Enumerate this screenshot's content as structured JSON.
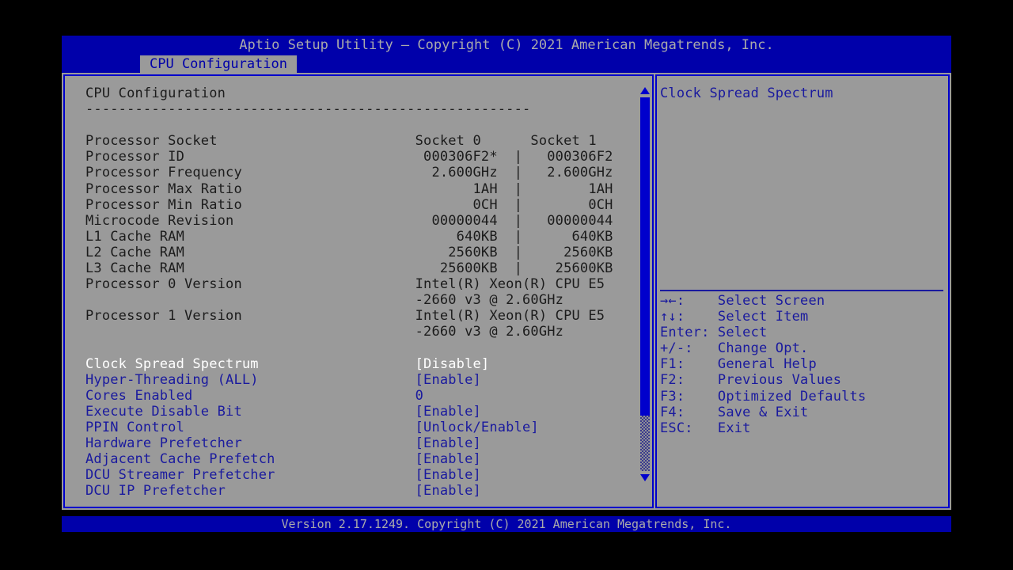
{
  "header": {
    "title": "Aptio Setup Utility – Copyright (C) 2021 American Megatrends, Inc.",
    "active_tab": "CPU Configuration"
  },
  "footer": {
    "version_line": "Version 2.17.1249. Copyright (C) 2021 American Megatrends, Inc."
  },
  "colors": {
    "background": "#000000",
    "panel": "#9a9a9a",
    "bar_blue": "#0000aa",
    "border_blue": "#0000cc",
    "text_blue": "#1a1a9e",
    "text_selected": "#ffffff",
    "title_text": "#aaaaaa"
  },
  "main": {
    "section_title": "CPU Configuration",
    "divider": "------------------------------------------------------",
    "info_rows": [
      {
        "label": "Processor Socket",
        "socket0": "Socket 0",
        "sep": " ",
        "socket1": "Socket 1"
      },
      {
        "label": "Processor ID",
        "socket0": "000306F2*",
        "sep": "|",
        "socket1": "000306F2"
      },
      {
        "label": "Processor Frequency",
        "socket0": "2.600GHz",
        "sep": "|",
        "socket1": "2.600GHz"
      },
      {
        "label": "Processor Max Ratio",
        "socket0": "1AH",
        "sep": "|",
        "socket1": "1AH"
      },
      {
        "label": "Processor Min Ratio",
        "socket0": "0CH",
        "sep": "|",
        "socket1": "0CH"
      },
      {
        "label": "Microcode Revision",
        "socket0": "00000044",
        "sep": "|",
        "socket1": "00000044"
      },
      {
        "label": "L1 Cache RAM",
        "socket0": "640KB",
        "sep": "|",
        "socket1": "640KB"
      },
      {
        "label": "L2 Cache RAM",
        "socket0": "2560KB",
        "sep": "|",
        "socket1": "2560KB"
      },
      {
        "label": "L3 Cache RAM",
        "socket0": "25600KB",
        "sep": "|",
        "socket1": "25600KB"
      }
    ],
    "version_blocks": [
      {
        "label": "Processor 0 Version",
        "line1": "Intel(R) Xeon(R) CPU E5",
        "line2": "-2660 v3 @ 2.60GHz"
      },
      {
        "label": "Processor 1 Version",
        "line1": "Intel(R) Xeon(R) CPU E5",
        "line2": "-2660 v3 @ 2.60GHz"
      }
    ],
    "settings": [
      {
        "label": "Clock Spread Spectrum",
        "value": "[Disable]",
        "selected": true
      },
      {
        "label": "Hyper-Threading (ALL)",
        "value": "[Enable]",
        "selected": false
      },
      {
        "label": "Cores Enabled",
        "value": "0",
        "selected": false
      },
      {
        "label": "Execute Disable Bit",
        "value": "[Enable]",
        "selected": false
      },
      {
        "label": "PPIN Control",
        "value": "[Unlock/Enable]",
        "selected": false
      },
      {
        "label": "Hardware Prefetcher",
        "value": "[Enable]",
        "selected": false
      },
      {
        "label": "Adjacent Cache Prefetch",
        "value": "[Enable]",
        "selected": false
      },
      {
        "label": "DCU Streamer Prefetcher",
        "value": "[Enable]",
        "selected": false
      },
      {
        "label": "DCU IP Prefetcher",
        "value": "[Enable]",
        "selected": false
      }
    ]
  },
  "help": {
    "title": "Clock Spread Spectrum",
    "keys": [
      {
        "key": "→←:",
        "action": "Select Screen"
      },
      {
        "key": "↑↓:",
        "action": "Select Item"
      },
      {
        "key": "Enter:",
        "action": "Select"
      },
      {
        "key": "+/-:",
        "action": "Change Opt."
      },
      {
        "key": "F1:",
        "action": "General Help"
      },
      {
        "key": "F2:",
        "action": "Previous Values"
      },
      {
        "key": "F3:",
        "action": "Optimized Defaults"
      },
      {
        "key": "F4:",
        "action": "Save & Exit"
      },
      {
        "key": "ESC:",
        "action": "Exit"
      }
    ]
  },
  "scrollbar": {
    "up_arrow": "scroll-up-arrow",
    "down_arrow": "scroll-down-arrow"
  }
}
